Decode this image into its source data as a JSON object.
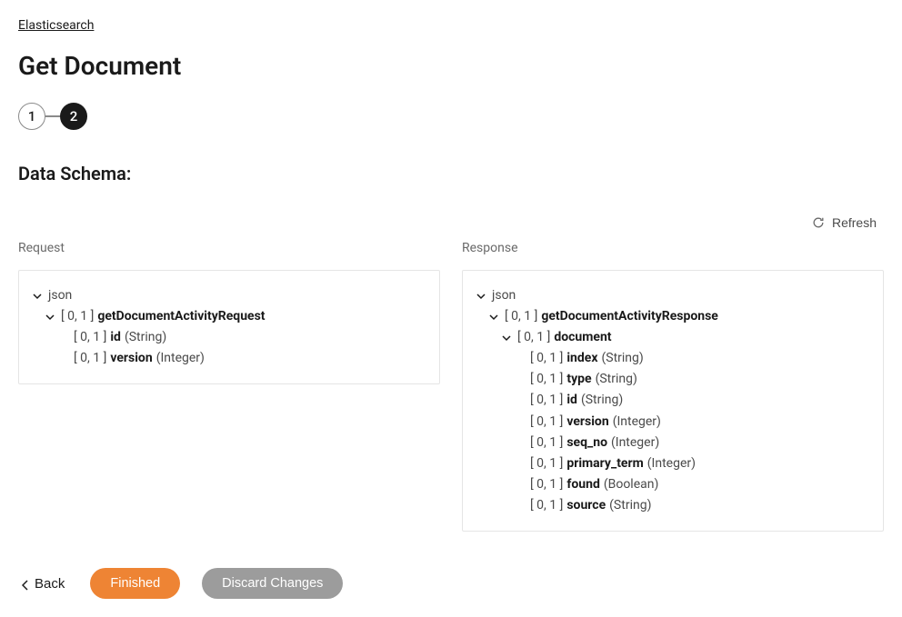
{
  "breadcrumb": {
    "root": "Elasticsearch"
  },
  "page_title": "Get Document",
  "stepper": {
    "step1": "1",
    "step2": "2"
  },
  "section_title": "Data Schema:",
  "refresh_label": "Refresh",
  "request": {
    "label": "Request",
    "root": "json",
    "root_cardinality": "[ 0, 1 ]",
    "root_object": "getDocumentActivityRequest",
    "fields": [
      {
        "cardinality": "[ 0, 1 ]",
        "name": "id",
        "type": "(String)"
      },
      {
        "cardinality": "[ 0, 1 ]",
        "name": "version",
        "type": "(Integer)"
      }
    ]
  },
  "response": {
    "label": "Response",
    "root": "json",
    "root_cardinality": "[ 0, 1 ]",
    "root_object": "getDocumentActivityResponse",
    "doc_cardinality": "[ 0, 1 ]",
    "doc_name": "document",
    "fields": [
      {
        "cardinality": "[ 0, 1 ]",
        "name": "index",
        "type": "(String)"
      },
      {
        "cardinality": "[ 0, 1 ]",
        "name": "type",
        "type": "(String)"
      },
      {
        "cardinality": "[ 0, 1 ]",
        "name": "id",
        "type": "(String)"
      },
      {
        "cardinality": "[ 0, 1 ]",
        "name": "version",
        "type": "(Integer)"
      },
      {
        "cardinality": "[ 0, 1 ]",
        "name": "seq_no",
        "type": "(Integer)"
      },
      {
        "cardinality": "[ 0, 1 ]",
        "name": "primary_term",
        "type": "(Integer)"
      },
      {
        "cardinality": "[ 0, 1 ]",
        "name": "found",
        "type": "(Boolean)"
      },
      {
        "cardinality": "[ 0, 1 ]",
        "name": "source",
        "type": "(String)"
      }
    ]
  },
  "footer": {
    "back": "Back",
    "finished": "Finished",
    "discard": "Discard Changes"
  }
}
